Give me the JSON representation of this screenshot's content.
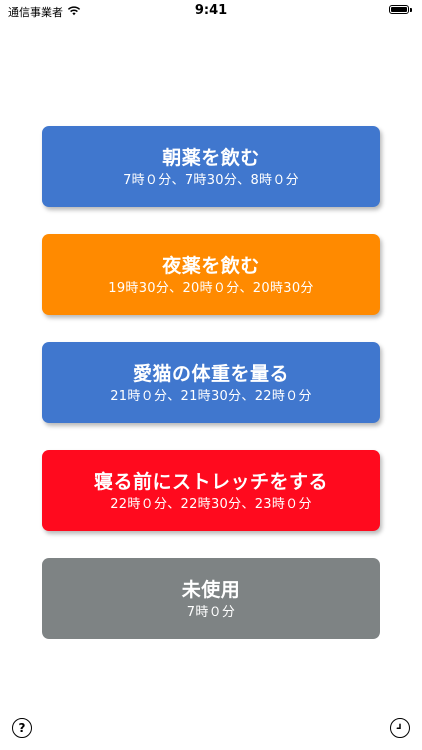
{
  "status_bar": {
    "carrier": "通信事業者",
    "time": "9:41",
    "icons": [
      "wifi-icon",
      "battery-icon"
    ]
  },
  "reminders": [
    {
      "title": "朝薬を飲む",
      "times": "7時０分、7時30分、8時０分",
      "color": "#4077CE"
    },
    {
      "title": "夜薬を飲む",
      "times": "19時30分、20時０分、20時30分",
      "color": "#FF8A00"
    },
    {
      "title": "愛猫の体重を量る",
      "times": "21時０分、21時30分、22時０分",
      "color": "#4077CE"
    },
    {
      "title": "寝る前にストレッチをする",
      "times": "22時０分、22時30分、23時０分",
      "color": "#FF0A1E"
    },
    {
      "title": "未使用",
      "times": "7時０分",
      "color": "#7E8384"
    }
  ],
  "toolbar": {
    "help_icon": "question-mark-icon",
    "clock_icon": "clock-icon"
  }
}
